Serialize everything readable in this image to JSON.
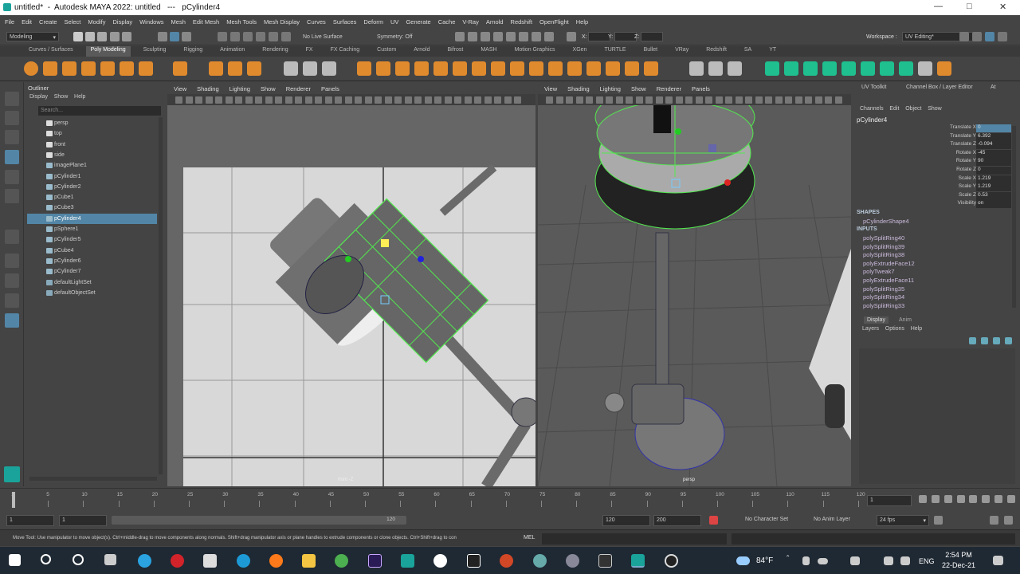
{
  "window": {
    "title": "untitled*  -  Autodesk MAYA 2022: untitled   ---   pCylinder4"
  },
  "menubar": [
    "File",
    "Edit",
    "Create",
    "Select",
    "Modify",
    "Display",
    "Windows",
    "Mesh",
    "Edit Mesh",
    "Mesh Tools",
    "Mesh Display",
    "Curves",
    "Surfaces",
    "Deform",
    "UV",
    "Generate",
    "Cache",
    "V-Ray",
    "Arnold",
    "Redshift",
    "OpenFlight",
    "Help"
  ],
  "statusline": {
    "mode": "Modeling",
    "live_surface": "No Live Surface",
    "symmetry": "Symmetry: Off",
    "coord_x": "X:",
    "coord_y": "Y:",
    "coord_z": "Z:",
    "workspace_label": "Workspace :",
    "workspace": "UV Editing*"
  },
  "shelf_tabs": [
    "Curves / Surfaces",
    "Poly Modeling",
    "Sculpting",
    "Rigging",
    "Animation",
    "Rendering",
    "FX",
    "FX Caching",
    "Custom",
    "Arnold",
    "Bifrost",
    "MASH",
    "Motion Graphics",
    "XGen",
    "TURTLE",
    "Bullet",
    "VRay",
    "Redshift",
    "SA",
    "YT"
  ],
  "shelf_active": "Poly Modeling",
  "outliner": {
    "title": "Outliner",
    "menu": [
      "Display",
      "Show",
      "Help"
    ],
    "search_placeholder": "Search...",
    "items": [
      {
        "label": "persp",
        "icon": "camera-icon",
        "selected": false
      },
      {
        "label": "top",
        "icon": "camera-icon",
        "selected": false
      },
      {
        "label": "front",
        "icon": "camera-icon",
        "selected": false
      },
      {
        "label": "side",
        "icon": "camera-icon",
        "selected": false
      },
      {
        "label": "imagePlane1",
        "icon": "image-plane-icon",
        "selected": false
      },
      {
        "label": "pCylinder1",
        "icon": "mesh-icon",
        "selected": false
      },
      {
        "label": "pCylinder2",
        "icon": "mesh-icon",
        "selected": false
      },
      {
        "label": "pCube1",
        "icon": "mesh-icon",
        "selected": false
      },
      {
        "label": "pCube3",
        "icon": "mesh-icon",
        "selected": false
      },
      {
        "label": "pCylinder4",
        "icon": "mesh-icon",
        "selected": true
      },
      {
        "label": "pSphere1",
        "icon": "mesh-icon",
        "selected": false
      },
      {
        "label": "pCylinder5",
        "icon": "mesh-icon",
        "selected": false
      },
      {
        "label": "pCube4",
        "icon": "mesh-icon",
        "selected": false
      },
      {
        "label": "pCylinder6",
        "icon": "mesh-icon",
        "selected": false
      },
      {
        "label": "pCylinder7",
        "icon": "mesh-icon",
        "selected": false
      },
      {
        "label": "defaultLightSet",
        "icon": "set-icon",
        "selected": false
      },
      {
        "label": "defaultObjectSet",
        "icon": "set-icon",
        "selected": false
      }
    ]
  },
  "viewport_menu": [
    "View",
    "Shading",
    "Lighting",
    "Show",
    "Renderer",
    "Panels"
  ],
  "viewport1": {
    "camera": "front -Z"
  },
  "viewport2": {
    "camera": "persp"
  },
  "channel_box": {
    "tabs": [
      "UV Toolkit",
      "Channel Box / Layer Editor",
      "At"
    ],
    "menu": [
      "Channels",
      "Edit",
      "Object",
      "Show"
    ],
    "object": "pCylinder4",
    "attributes": [
      {
        "label": "Translate X",
        "value": "0"
      },
      {
        "label": "Translate Y",
        "value": "6.392"
      },
      {
        "label": "Translate Z",
        "value": "-0.094"
      },
      {
        "label": "Rotate X",
        "value": "-45"
      },
      {
        "label": "Rotate Y",
        "value": "90"
      },
      {
        "label": "Rotate Z",
        "value": "0"
      },
      {
        "label": "Scale X",
        "value": "1.219"
      },
      {
        "label": "Scale Y",
        "value": "1.219"
      },
      {
        "label": "Scale Z",
        "value": "0.53"
      },
      {
        "label": "Visibility",
        "value": "on"
      }
    ],
    "shapes_label": "SHAPES",
    "shape": "pCylinderShape4",
    "inputs_label": "INPUTS",
    "inputs": [
      "polySplitRing40",
      "polySplitRing39",
      "polySplitRing38",
      "polyExtrudeFace12",
      "polyTweak7",
      "polyExtrudeFace11",
      "polySplitRing35",
      "polySplitRing34",
      "polySplitRing33"
    ]
  },
  "layer_editor": {
    "tabs": [
      "Display",
      "Anim"
    ],
    "menu": [
      "Layers",
      "Options",
      "Help"
    ]
  },
  "timeslider": {
    "ticks": [
      "1",
      "5",
      "10",
      "15",
      "20",
      "25",
      "30",
      "35",
      "40",
      "45",
      "50",
      "55",
      "60",
      "65",
      "70",
      "75",
      "80",
      "85",
      "90",
      "95",
      "100",
      "105",
      "110",
      "115",
      "120"
    ],
    "current": "1"
  },
  "range": {
    "start": "1",
    "start2": "1",
    "range_end_label": "120",
    "end": "120",
    "end2": "200",
    "character_set": "No Character Set",
    "anim_layer": "No Anim Layer",
    "fps": "24 fps"
  },
  "help_line": {
    "message": "Move Tool: Use manipulator to move object(s). Ctrl+middle-drag to move components along normals. Shift+drag manipulator axis or plane handles to extrude components or clone objects. Ctrl+Shift+drag to con",
    "mel": "MEL"
  },
  "taskbar": {
    "weather": "84°F",
    "lang": "ENG",
    "time": "2:54 PM",
    "date": "22-Dec-21"
  },
  "colors": {
    "selection": "#5285a6",
    "wireframe": "#52e84e",
    "panel": "#444444"
  }
}
